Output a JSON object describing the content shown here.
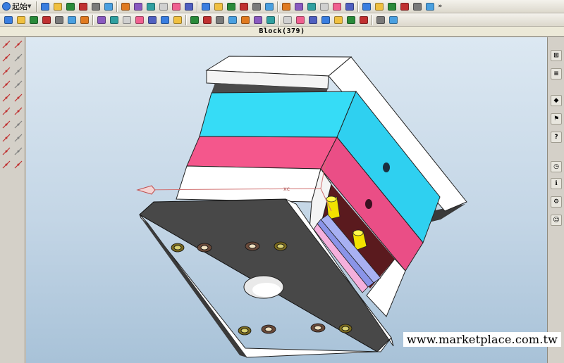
{
  "toolbar": {
    "start_label": "起始",
    "row1_icons": [
      "new-file-icon",
      "open-folder-icon",
      "save-icon",
      "cut-icon",
      "copy-icon",
      "paste-icon",
      "delete-icon",
      "undo-icon",
      "select-icon",
      "frame-icon",
      "shaded-icon",
      "zoom-icon",
      "rotate-icon",
      "pan-icon",
      "view-icon",
      "solid-cube-icon",
      "shade-mode-icon",
      "active-select-icon",
      "measure-icon",
      "appearance-icon",
      "layer-icon",
      "ruler-icon",
      "dimension-icon",
      "edge-icon",
      "face-icon",
      "curve-icon",
      "fillet-icon",
      "chamfer-icon",
      "pattern-icon",
      "book-icon",
      "gem-icon"
    ],
    "row2_icons": [
      "part-icon",
      "feature-icon",
      "sketch-icon",
      "plane-icon",
      "axis-icon",
      "point-icon",
      "assembly-icon",
      "component-icon",
      "mate-icon",
      "explode-icon",
      "boolean-icon",
      "shell-icon",
      "draft-icon",
      "rib-icon",
      "hole-icon",
      "thread-icon",
      "mirror-icon",
      "scale-icon",
      "move-icon",
      "rotate-body-icon",
      "split-icon",
      "trim-icon",
      "extend-icon",
      "offset-icon",
      "blend-icon",
      "surface-icon",
      "loft-icon",
      "sweep-icon",
      "revolve-icon",
      "settings-icon"
    ],
    "more_label": "»"
  },
  "title": "Block(379)",
  "left_tools": [
    "select-icon",
    "line-icon",
    "arc-icon",
    "circle-icon",
    "rect-icon",
    "polygon-icon",
    "spline-icon",
    "point-icon",
    "trim-icon",
    "extend-icon",
    "offset-icon",
    "mirror-icon",
    "fillet-icon",
    "chamfer-icon",
    "dimension-icon",
    "constraint-icon",
    "hole-icon",
    "pattern-icon",
    "project-icon",
    "intersect-icon"
  ],
  "right_tools": [
    "tree-icon",
    "layers-icon",
    "palette-icon",
    "library-icon",
    "help-icon",
    "history-icon",
    "info-icon",
    "settings-icon",
    "users-icon"
  ],
  "right_tool_glyphs": [
    "⊞",
    "≡",
    "◆",
    "⚑",
    "?",
    "◷",
    "ℹ",
    "⚙",
    "☺"
  ],
  "viewport": {
    "axis_label": "xc",
    "colors": {
      "top_plate": "#ffffff",
      "cyan_plate": "#36dcf6",
      "cyan_side": "#26c4e8",
      "pink_plate": "#f4578c",
      "pink_side": "#e84a80",
      "base_plate": "#484848",
      "cavity": "#5a1a1e",
      "yellow_pin": "#f2e100",
      "lavender": "#a8b0f2",
      "light_pink": "#f5b0dc",
      "background_top": "#dce8f2",
      "background_bottom": "#a8c2d8"
    }
  },
  "watermark": "www.marketplace.com.tw"
}
